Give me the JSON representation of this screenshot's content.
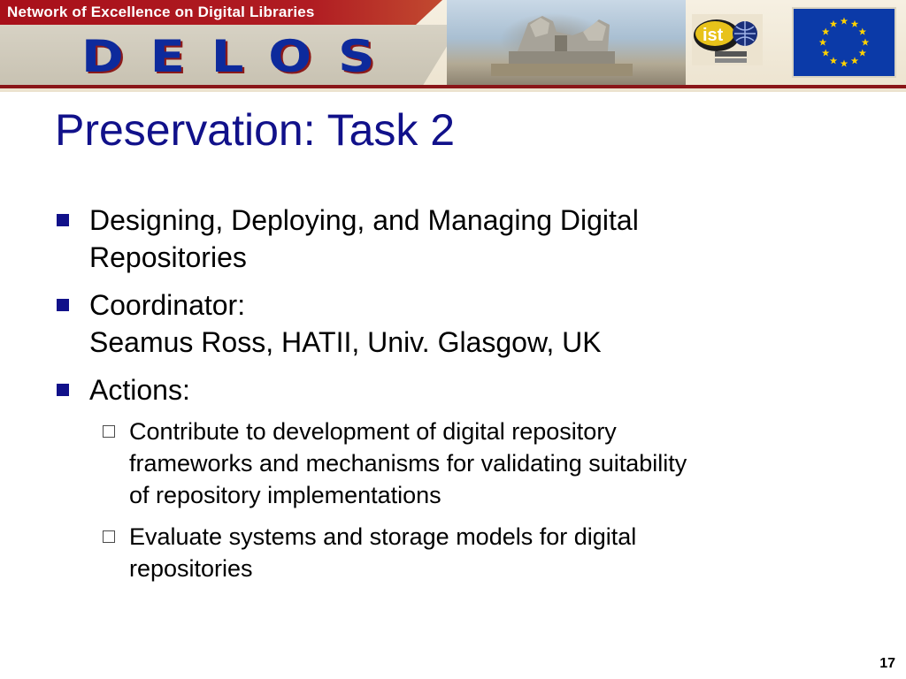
{
  "banner": {
    "network_label": "Network of Excellence on Digital Libraries",
    "logo_text": "DELOS",
    "ist_logo_text": "ist"
  },
  "slide": {
    "title": "Preservation: Task 2",
    "bullets": [
      {
        "lines": [
          "Designing, Deploying, and Managing Digital",
          "Repositories"
        ]
      },
      {
        "lines": [
          "Coordinator:",
          "Seamus Ross, HATII, Univ. Glasgow, UK"
        ]
      },
      {
        "lines": [
          "Actions:"
        ],
        "sub_items": [
          {
            "lines": [
              "Contribute to development of digital repository",
              "frameworks and mechanisms for validating suitability",
              "of repository implementations"
            ]
          },
          {
            "lines": [
              "Evaluate systems and storage models for digital",
              "repositories"
            ]
          }
        ]
      }
    ],
    "page_number": "17"
  },
  "colors": {
    "title": "#11118a",
    "banner_red": "#a8101a",
    "logo_blue": "#0d2a9c",
    "eu_blue": "#0b3aa8",
    "eu_star": "#ffd200"
  },
  "icons": {
    "bullet": "square-bullet-icon",
    "sub_bullet": "hollow-square-bullet-icon",
    "sculpture": "lion-gate-sculpture-image",
    "ist": "ist-logo",
    "eu": "eu-flag-icon"
  }
}
